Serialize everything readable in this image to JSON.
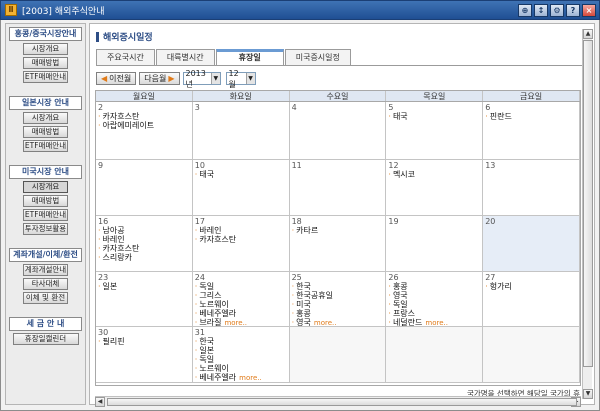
{
  "window": {
    "title": "[2003] 해외주식안내",
    "app_icon": "Ⅱ"
  },
  "sidebar": {
    "hk": {
      "header": "홍콩/중국시장안내",
      "items": [
        "시장개요",
        "매매방법",
        "ETF매매안내"
      ]
    },
    "jp": {
      "header": "일본시장 안내",
      "items": [
        "시장개요",
        "매매방법",
        "ETF매매안내"
      ]
    },
    "us": {
      "header": "미국시장 안내",
      "items": [
        "시장개요",
        "매매방법",
        "ETF매매안내",
        "투자정보활용"
      ]
    },
    "acct": {
      "header": "계좌개설/이체/환전",
      "items": [
        "계좌개설안내",
        "타사대체",
        "이체 및 환전"
      ]
    },
    "tax": {
      "header": "세 금 안 내",
      "items": [
        "휴장일캘린더"
      ]
    }
  },
  "main": {
    "title": "해외증시일정",
    "tabs": [
      "주요국시간",
      "대륙별시간",
      "휴장일",
      "미국증시일정"
    ],
    "nav": {
      "prev": "이전월",
      "next": "다음월",
      "year": "2013년",
      "month": "12월"
    },
    "weekdays": [
      "월요일",
      "화요일",
      "수요일",
      "목요일",
      "금요일"
    ],
    "more_label": "more..",
    "notice": "국가명을 선택하면 해당일 국가의 휴"
  },
  "calendar": [
    [
      {
        "day": "2",
        "hol": [
          "카자흐스탄",
          "아랍에미레이트"
        ]
      },
      {
        "day": "3",
        "hol": []
      },
      {
        "day": "4",
        "hol": []
      },
      {
        "day": "5",
        "hol": [
          "태국"
        ]
      },
      {
        "day": "6",
        "hol": [
          "핀란드"
        ]
      }
    ],
    [
      {
        "day": "9",
        "hol": []
      },
      {
        "day": "10",
        "hol": [
          "태국"
        ]
      },
      {
        "day": "11",
        "hol": []
      },
      {
        "day": "12",
        "hol": [
          "멕시코"
        ]
      },
      {
        "day": "13",
        "hol": []
      }
    ],
    [
      {
        "day": "16",
        "hol": [
          "남아공",
          "바레인",
          "카자흐스탄",
          "스리랑카"
        ]
      },
      {
        "day": "17",
        "hol": [
          "바레인",
          "카자흐스탄"
        ]
      },
      {
        "day": "18",
        "hol": [
          "카타르"
        ]
      },
      {
        "day": "19",
        "hol": []
      },
      {
        "day": "20",
        "hol": [],
        "hl": true
      }
    ],
    [
      {
        "day": "23",
        "hol": [
          "일본"
        ]
      },
      {
        "day": "24",
        "hol": [
          "독일",
          "그리스",
          "노르웨이",
          "베네주엘라",
          "브라질"
        ],
        "more": true
      },
      {
        "day": "25",
        "hol": [
          "한국",
          "한국공휴일",
          "미국",
          "홍콩",
          "영국"
        ],
        "more": true
      },
      {
        "day": "26",
        "hol": [
          "홍콩",
          "영국",
          "독일",
          "프랑스",
          "네덜란드"
        ],
        "more": true
      },
      {
        "day": "27",
        "hol": [
          "헝가리"
        ]
      }
    ],
    [
      {
        "day": "30",
        "hol": [
          "필리핀"
        ]
      },
      {
        "day": "31",
        "hol": [
          "한국",
          "일본",
          "독일",
          "노르웨이",
          "베네주엘라"
        ],
        "more": true
      },
      {
        "day": "",
        "hol": [],
        "blank": true
      },
      {
        "day": "",
        "hol": [],
        "blank": true
      },
      {
        "day": "",
        "hol": [],
        "blank": true
      }
    ]
  ],
  "colors": {
    "accent": "#2e4e86",
    "highlight": "#e07b1a",
    "titlebar": "#2b5fa4"
  }
}
